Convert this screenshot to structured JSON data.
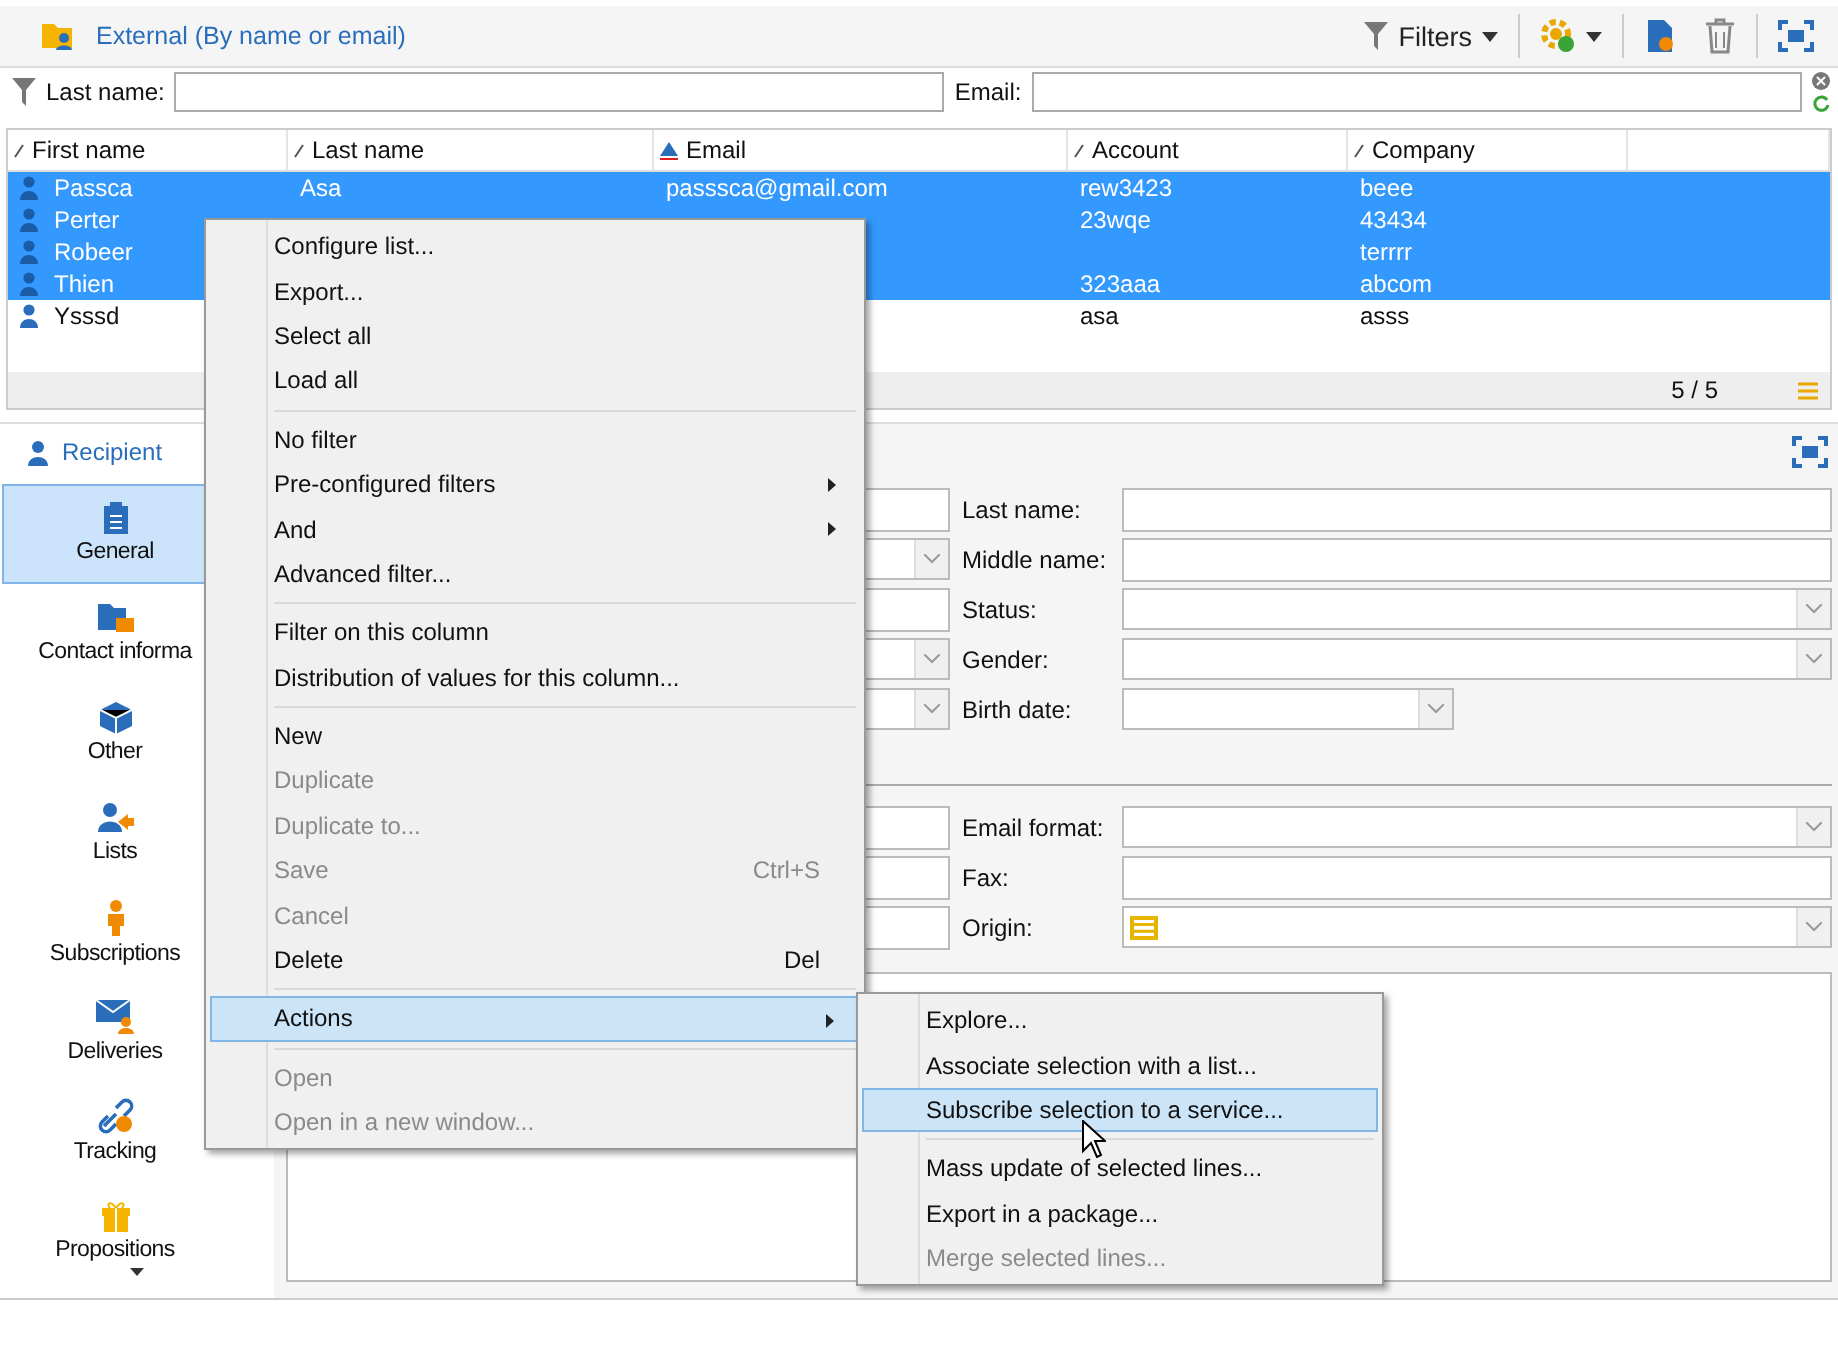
{
  "toolbar": {
    "title": "External (By name or email)",
    "filters_button": "Filters"
  },
  "filter_bar": {
    "fields": [
      {
        "label": "Last name:"
      },
      {
        "label": "Email:"
      }
    ]
  },
  "table": {
    "columns": [
      {
        "label": "First name",
        "sorted": false
      },
      {
        "label": "Last name",
        "sorted": false
      },
      {
        "label": "Email",
        "sorted": true
      },
      {
        "label": "Account",
        "sorted": false
      },
      {
        "label": "Company",
        "sorted": false
      }
    ],
    "rows": [
      {
        "selected": true,
        "cells": [
          "Passca",
          "Asa",
          "passsca@gmail.com",
          "rew3423",
          "beee"
        ]
      },
      {
        "selected": true,
        "cells": [
          "Perter",
          null,
          null,
          "23wqe",
          "43434"
        ]
      },
      {
        "selected": true,
        "cells": [
          "Robeer",
          null,
          null,
          null,
          "terrrr"
        ]
      },
      {
        "selected": true,
        "cells": [
          "Thien",
          null,
          null,
          "323aaa",
          "abcom"
        ]
      },
      {
        "selected": false,
        "cells": [
          "Ysssd",
          null,
          null,
          "asa",
          "asss"
        ]
      }
    ],
    "count": "5 / 5"
  },
  "panel": {
    "title": "Recipient"
  },
  "sidebar": {
    "items": [
      {
        "label": "General",
        "selected": true
      },
      {
        "label": "Contact informa",
        "selected": false
      },
      {
        "label": "Other",
        "selected": false
      },
      {
        "label": "Lists",
        "selected": false
      },
      {
        "label": "Subscriptions",
        "selected": false
      },
      {
        "label": "Deliveries",
        "selected": false
      },
      {
        "label": "Tracking",
        "selected": false
      },
      {
        "label": "Propositions",
        "selected": false
      }
    ]
  },
  "form": {
    "sections": [
      [
        {
          "left_field": {
            "kind": "text"
          },
          "label": "Last name:",
          "kind": "text"
        },
        {
          "left_field": {
            "kind": "select"
          },
          "label": "Middle name:",
          "kind": "text"
        },
        {
          "left_field": {
            "kind": "text"
          },
          "label": "Status:",
          "kind": "select"
        },
        {
          "left_field": {
            "kind": "select"
          },
          "label": "Gender:",
          "kind": "select"
        },
        {
          "left_field": {
            "kind": "select"
          },
          "label": "Birth date:",
          "kind": "date"
        }
      ],
      [
        {
          "left_field": {
            "kind": "text"
          },
          "label": "Email format:",
          "kind": "select"
        },
        {
          "left_field": {
            "kind": "text"
          },
          "label": "Fax:",
          "kind": "text"
        },
        {
          "left_field": {
            "kind": "text"
          },
          "label": "Origin:",
          "kind": "origin"
        }
      ]
    ]
  },
  "context_menu": {
    "groups": [
      [
        {
          "label": "Configure list...",
          "disabled": false,
          "selected": false
        },
        {
          "label": "Export...",
          "disabled": false,
          "selected": false
        },
        {
          "label": "Select all",
          "disabled": false,
          "selected": false
        },
        {
          "label": "Load all",
          "disabled": false,
          "selected": false
        }
      ],
      [
        {
          "label": "No filter",
          "disabled": false,
          "selected": false
        },
        {
          "label": "Pre-configured filters",
          "disabled": false,
          "selected": false,
          "submenu": true
        },
        {
          "label": "And",
          "disabled": false,
          "selected": false,
          "submenu": true
        },
        {
          "label": "Advanced filter...",
          "disabled": false,
          "selected": false
        }
      ],
      [
        {
          "label": "Filter on this column",
          "disabled": false,
          "selected": false
        },
        {
          "label": "Distribution of values for this column...",
          "disabled": false,
          "selected": false
        }
      ],
      [
        {
          "label": "New",
          "disabled": false,
          "selected": false
        },
        {
          "label": "Duplicate",
          "disabled": true,
          "selected": false
        },
        {
          "label": "Duplicate to...",
          "disabled": true,
          "selected": false
        },
        {
          "label": "Save",
          "disabled": true,
          "selected": false,
          "shortcut": "Ctrl+S"
        },
        {
          "label": "Cancel",
          "disabled": true,
          "selected": false
        },
        {
          "label": "Delete",
          "disabled": false,
          "selected": false,
          "shortcut": "Del"
        }
      ],
      [
        {
          "label": "Actions",
          "disabled": false,
          "selected": true,
          "submenu": true
        }
      ],
      [
        {
          "label": "Open",
          "disabled": true,
          "selected": false
        },
        {
          "label": "Open in a new window...",
          "disabled": true,
          "selected": false
        }
      ]
    ]
  },
  "submenu": {
    "groups": [
      [
        {
          "label": "Explore...",
          "disabled": false,
          "selected": false
        },
        {
          "label": "Associate selection with a list...",
          "disabled": false,
          "selected": false
        },
        {
          "label": "Subscribe selection to a service...",
          "disabled": false,
          "selected": true
        }
      ],
      [
        {
          "label": "Mass update of selected lines...",
          "disabled": false,
          "selected": false
        },
        {
          "label": "Export in a package...",
          "disabled": false,
          "selected": false
        },
        {
          "label": "Merge selected lines...",
          "disabled": true,
          "selected": false
        }
      ]
    ]
  }
}
